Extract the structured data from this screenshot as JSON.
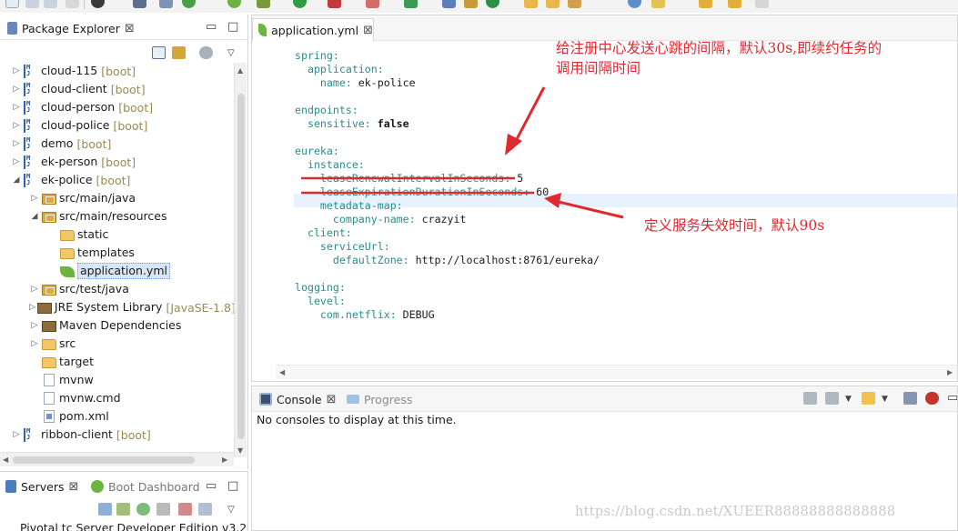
{
  "package_explorer": {
    "tab_label": "Package Explorer",
    "close_glyph": "⊠",
    "items": [
      {
        "label": "cloud-115",
        "suffix": "[boot]",
        "icon": "maven-project-icon",
        "twisty": "▷"
      },
      {
        "label": "cloud-client",
        "suffix": "[boot]",
        "icon": "maven-project-icon",
        "twisty": "▷"
      },
      {
        "label": "cloud-person",
        "suffix": "[boot]",
        "icon": "maven-project-icon",
        "twisty": "▷"
      },
      {
        "label": "cloud-police",
        "suffix": "[boot]",
        "icon": "maven-project-icon",
        "twisty": "▷"
      },
      {
        "label": "demo",
        "suffix": "[boot]",
        "icon": "maven-project-icon",
        "twisty": "▷"
      },
      {
        "label": "ek-person",
        "suffix": "[boot]",
        "icon": "maven-project-icon",
        "twisty": "▷"
      },
      {
        "label": "ek-police",
        "suffix": "[boot]",
        "icon": "maven-project-icon",
        "twisty": "◢"
      },
      {
        "label": "src/main/java",
        "suffix": "",
        "icon": "source-folder-icon",
        "twisty": "▷"
      },
      {
        "label": "src/main/resources",
        "suffix": "",
        "icon": "source-folder-icon",
        "twisty": "◢"
      },
      {
        "label": "static",
        "suffix": "",
        "icon": "folder-icon",
        "twisty": ""
      },
      {
        "label": "templates",
        "suffix": "",
        "icon": "folder-icon",
        "twisty": ""
      },
      {
        "label": "application.yml",
        "suffix": "",
        "icon": "spring-yml-icon",
        "twisty": ""
      },
      {
        "label": "src/test/java",
        "suffix": "",
        "icon": "source-folder-icon",
        "twisty": "▷"
      },
      {
        "label": "JRE System Library",
        "suffix": "[JavaSE-1.8]",
        "icon": "library-icon",
        "twisty": "▷"
      },
      {
        "label": "Maven Dependencies",
        "suffix": "",
        "icon": "library-icon",
        "twisty": "▷"
      },
      {
        "label": "src",
        "suffix": "",
        "icon": "folder-icon",
        "twisty": "▷"
      },
      {
        "label": "target",
        "suffix": "",
        "icon": "folder-icon",
        "twisty": ""
      },
      {
        "label": "mvnw",
        "suffix": "",
        "icon": "file-icon",
        "twisty": ""
      },
      {
        "label": "mvnw.cmd",
        "suffix": "",
        "icon": "file-icon",
        "twisty": ""
      },
      {
        "label": "pom.xml",
        "suffix": "",
        "icon": "xml-file-icon",
        "twisty": ""
      },
      {
        "label": "ribbon-client",
        "suffix": "[boot]",
        "icon": "maven-project-icon",
        "twisty": "▷"
      }
    ]
  },
  "servers": {
    "tab_servers": "Servers",
    "tab_boot_dashboard": "Boot Dashboard",
    "close_glyph": "⊠",
    "first_server": "Pivotal tc Server Developer Edition v3.2"
  },
  "editor": {
    "tab_label": "application.yml",
    "close_glyph": "⊠",
    "lines": [
      {
        "key": "spring:",
        "value": ""
      },
      {
        "key": "  application:",
        "value": ""
      },
      {
        "key": "    name:",
        "value": " ek-police"
      },
      {
        "key": "",
        "value": ""
      },
      {
        "key": "endpoints:",
        "value": ""
      },
      {
        "key": "  sensitive:",
        "value": " false"
      },
      {
        "key": "",
        "value": ""
      },
      {
        "key": "eureka:",
        "value": ""
      },
      {
        "key": "  instance:",
        "value": ""
      },
      {
        "key": "    leaseRenewalIntervalInSeconds:",
        "value": " 5"
      },
      {
        "key": "    leaseExpirationDurationInSeconds:",
        "value": " 60"
      },
      {
        "key": "    metadata-map:",
        "value": ""
      },
      {
        "key": "      company-name:",
        "value": " crazyit"
      },
      {
        "key": "  client:",
        "value": ""
      },
      {
        "key": "    serviceUrl:",
        "value": ""
      },
      {
        "key": "      defaultZone:",
        "value": " http://localhost:8761/eureka/"
      },
      {
        "key": "",
        "value": ""
      },
      {
        "key": "logging:",
        "value": ""
      },
      {
        "key": "  level:",
        "value": ""
      },
      {
        "key": "    com.netflix:",
        "value": " DEBUG"
      }
    ]
  },
  "console": {
    "tab_console": "Console",
    "tab_progress": "Progress",
    "close_glyph": "⊠",
    "message": "No consoles to display at this time."
  },
  "annotations": {
    "heartbeat_note_line1": "给注册中心发送心跳的间隔，默认30s,即续约任务的",
    "heartbeat_note_line2": "调用间隔时间",
    "expiration_note": "定义服务失效时间，默认90s",
    "color": "#e0282f"
  },
  "watermark": "https://blog.csdn.net/XUEER88888888888888"
}
